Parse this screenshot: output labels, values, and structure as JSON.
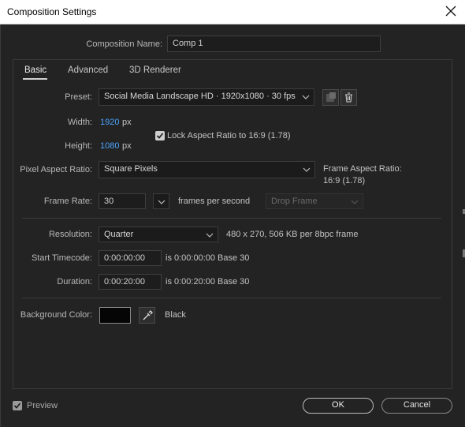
{
  "window": {
    "title": "Composition Settings"
  },
  "comp_name": {
    "label": "Composition Name:",
    "value": "Comp 1"
  },
  "tabs": [
    {
      "label": "Basic",
      "active": true
    },
    {
      "label": "Advanced",
      "active": false
    },
    {
      "label": "3D Renderer",
      "active": false
    }
  ],
  "preset": {
    "label": "Preset:",
    "value": "Social Media Landscape HD  ·  1920x1080 · 30 fps"
  },
  "width": {
    "label": "Width:",
    "value": "1920",
    "unit": "px"
  },
  "height": {
    "label": "Height:",
    "value": "1080",
    "unit": "px"
  },
  "lock_aspect": {
    "label": "Lock Aspect Ratio to 16:9 (1.78)",
    "checked": true
  },
  "pixel_aspect": {
    "label": "Pixel Aspect Ratio:",
    "value": "Square Pixels"
  },
  "frame_aspect": {
    "label": "Frame Aspect Ratio:",
    "value": "16:9 (1.78)"
  },
  "frame_rate": {
    "label": "Frame Rate:",
    "value": "30",
    "unit": "frames per second",
    "drop_frame": "Drop Frame"
  },
  "resolution": {
    "label": "Resolution:",
    "value": "Quarter",
    "info": "480 x 270, 506 KB per 8bpc frame"
  },
  "start_timecode": {
    "label": "Start Timecode:",
    "value": "0:00:00:00",
    "info": "is 0:00:00:00  Base 30"
  },
  "duration": {
    "label": "Duration:",
    "value": "0:00:20:00",
    "info": "is 0:00:20:00  Base 30"
  },
  "background": {
    "label": "Background Color:",
    "color_name": "Black",
    "color": "#050505"
  },
  "preview": {
    "label": "Preview",
    "checked": true
  },
  "buttons": {
    "ok": "OK",
    "cancel": "Cancel"
  }
}
